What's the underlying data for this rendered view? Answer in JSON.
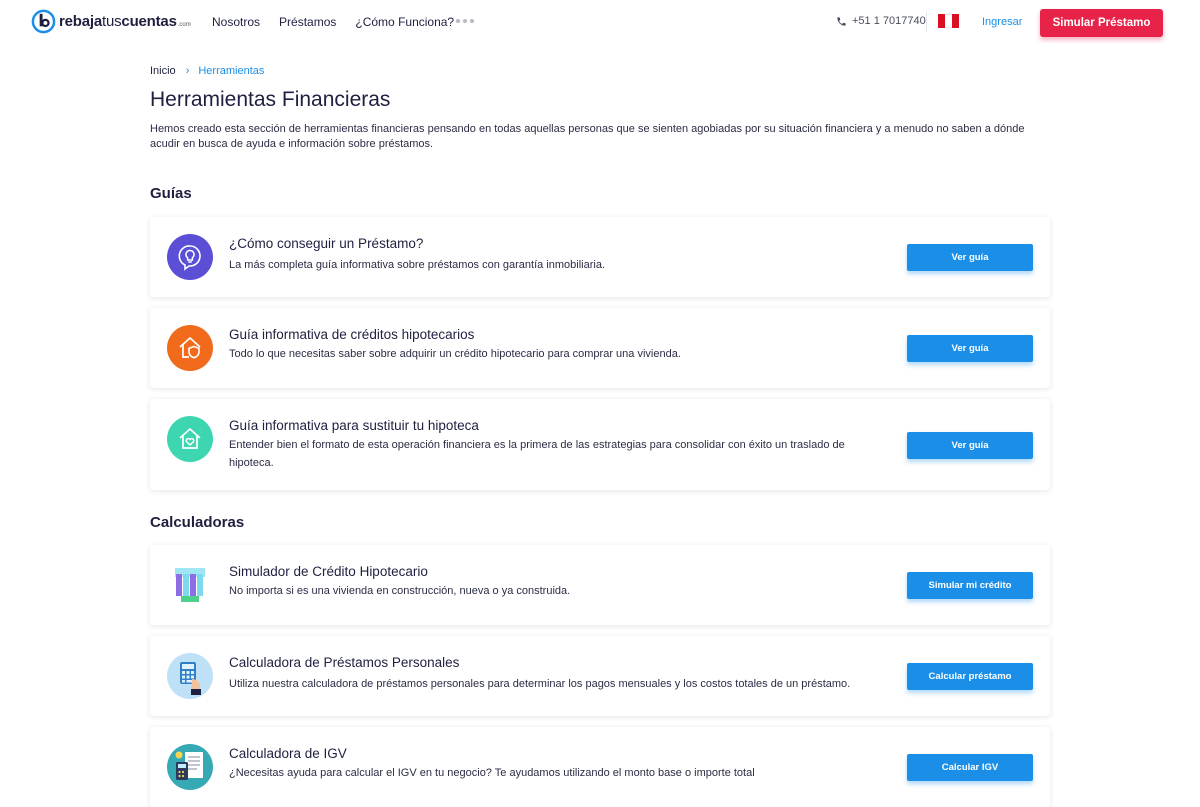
{
  "header": {
    "logo": {
      "bold": "rebaja",
      "light": "tus",
      "bold2": "cuentas",
      "suffix": ".com"
    },
    "nav": [
      "Nosotros",
      "Préstamos",
      "¿Cómo Funciona?"
    ],
    "more_icon": "ellipsis-icon",
    "phone": "+51 1 7017740",
    "phone_icon": "phone-icon",
    "flag_icon": "peru-flag-icon",
    "login": "Ingresar",
    "cta": "Simular Préstamo"
  },
  "breadcrumb": {
    "home": "Inicio",
    "current": "Herramientas"
  },
  "page_title": "Herramientas Financieras",
  "intro": "Hemos creado esta sección de herramientas financieras pensando en todas aquellas personas que se sienten agobiadas por su situación financiera y a menudo no saben a dónde acudir en busca de ayuda e información sobre préstamos.",
  "sections": {
    "guides_title": "Guías",
    "calculators_title": "Calculadoras"
  },
  "guides": [
    {
      "title": "¿Cómo conseguir un Préstamo?",
      "desc": "La más completa guía informativa sobre préstamos con garantía inmobiliaria.",
      "button": "Ver guía",
      "icon": "lightbulb-chat-icon",
      "color": "#5b4fd6"
    },
    {
      "title": "Guía informativa de créditos hipotecarios",
      "desc": "Todo lo que necesitas saber sobre adquirir un crédito hipotecario para comprar una vivienda.",
      "button": "Ver guía",
      "icon": "house-shield-icon",
      "color": "#f26a1b"
    },
    {
      "title": "Guía informativa para sustituir tu hipoteca",
      "desc": "Entender bien el formato de esta operación financiera es la primera de las estrategias para consolidar con éxito un traslado de hipoteca.",
      "button": "Ver guía",
      "icon": "house-heart-icon",
      "color": "#3dd6b0"
    }
  ],
  "calculators": [
    {
      "title": "Simulador de Crédito Hipotecario",
      "desc": "No importa si es una vivienda en construcción, nueva o ya construida.",
      "button": "Simular mi crédito",
      "icon": "building-icon"
    },
    {
      "title": "Calculadora de Préstamos Personales",
      "desc": "Utiliza nuestra calculadora de préstamos personales para determinar los pagos mensuales y los costos totales de un préstamo.",
      "button": "Calcular préstamo",
      "icon": "calculator-hand-icon"
    },
    {
      "title": "Calculadora de IGV",
      "desc": "¿Necesitas ayuda para calcular el IGV en tu negocio? Te ayudamos utilizando el monto base o importe total",
      "button": "Calcular IGV",
      "icon": "invoice-calculator-icon"
    }
  ]
}
